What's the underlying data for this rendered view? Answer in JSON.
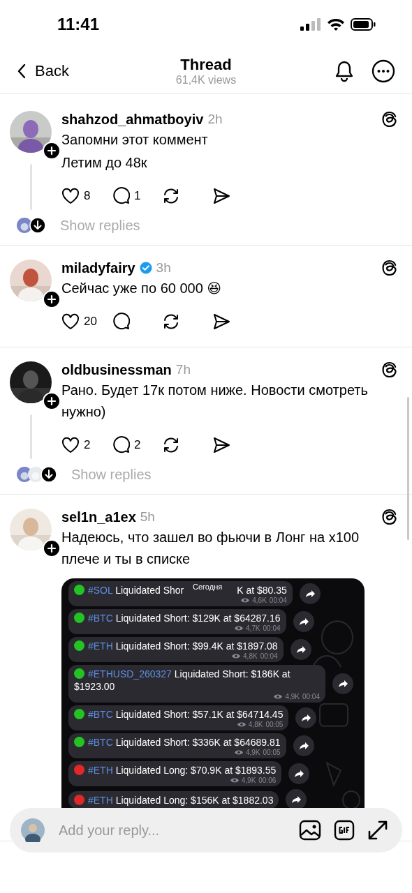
{
  "status_bar": {
    "time": "11:41"
  },
  "header": {
    "back": "Back",
    "title": "Thread",
    "views": "61,4K views"
  },
  "posts": [
    {
      "username": "shahzod_ahmatboyiv",
      "verified": false,
      "time": "2h",
      "lines": [
        "Запомни этот коммент",
        "Летим до 48к"
      ],
      "likes": "8",
      "comments": "1",
      "has_replies": true,
      "show_replies": "Show replies",
      "reply_avatars": [
        {
          "kind": "picture"
        }
      ]
    },
    {
      "username": "miladyfairy",
      "verified": true,
      "time": "3h",
      "lines": [
        "Сейчас уже по 60 000 😆"
      ],
      "likes": "20",
      "has_replies": false
    },
    {
      "username": "oldbusinessman",
      "verified": false,
      "time": "7h",
      "lines": [
        "Рано. Будет 17к потом ниже. Новости смотреть нужно)"
      ],
      "likes": "2",
      "comments": "2",
      "has_replies": true,
      "show_replies": "Show replies",
      "reply_avatars": [
        {
          "kind": "picture"
        },
        {
          "kind": "picture"
        }
      ]
    },
    {
      "username": "sel1n_a1ex",
      "verified": false,
      "time": "5h",
      "lines": [
        "Надеюсь, что зашел во фьючи в Лонг на x100 плече и ты в списке"
      ],
      "has_replies": false,
      "attachment": {
        "date_pill": "Сегодня",
        "messages": [
          {
            "color": "#22c322",
            "tag": "#SOL",
            "text": "Liquidated Shor",
            "text_after": "K at $80.35",
            "views": "4,6K",
            "time": "00:04"
          },
          {
            "color": "#22c322",
            "tag": "#BTC",
            "text": "Liquidated Short: $129K at $64287.16",
            "views": "4,7K",
            "time": "00:04"
          },
          {
            "color": "#22c322",
            "tag": "#ETH",
            "text": "Liquidated Short: $99.4K at $1897.08",
            "views": "4,8K",
            "time": "00:04"
          },
          {
            "color": "#22c322",
            "tag": "#ETHUSD_260327",
            "text": "Liquidated Short: $186K at $1923.00",
            "views": "4,9K",
            "time": "00:04"
          },
          {
            "color": "#22c322",
            "tag": "#BTC",
            "text": "Liquidated Short: $57.1K at $64714.45",
            "views": "4,8K",
            "time": "00:05"
          },
          {
            "color": "#22c322",
            "tag": "#BTC",
            "text": "Liquidated Short: $336K at $64689.81",
            "views": "4,9K",
            "time": "00:05"
          },
          {
            "color": "#e02828",
            "tag": "#ETH",
            "text": "Liquidated Long: $70.9K at $1893.55",
            "views": "4,9K",
            "time": "00:06"
          },
          {
            "color": "#e02828",
            "tag": "#ETH",
            "text": "Liquidated Long: $156K at $1882.03"
          }
        ]
      }
    }
  ],
  "composer": {
    "placeholder": "Add your reply..."
  }
}
